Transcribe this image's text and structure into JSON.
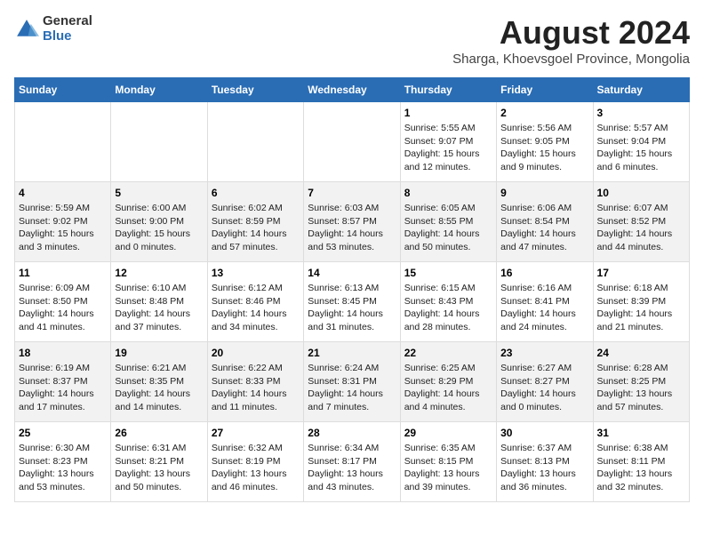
{
  "logo": {
    "general": "General",
    "blue": "Blue"
  },
  "title": "August 2024",
  "subtitle": "Sharga, Khoevsgoel Province, Mongolia",
  "days_of_week": [
    "Sunday",
    "Monday",
    "Tuesday",
    "Wednesday",
    "Thursday",
    "Friday",
    "Saturday"
  ],
  "weeks": [
    [
      {
        "day": "",
        "info": ""
      },
      {
        "day": "",
        "info": ""
      },
      {
        "day": "",
        "info": ""
      },
      {
        "day": "",
        "info": ""
      },
      {
        "day": "1",
        "info": "Sunrise: 5:55 AM\nSunset: 9:07 PM\nDaylight: 15 hours\nand 12 minutes."
      },
      {
        "day": "2",
        "info": "Sunrise: 5:56 AM\nSunset: 9:05 PM\nDaylight: 15 hours\nand 9 minutes."
      },
      {
        "day": "3",
        "info": "Sunrise: 5:57 AM\nSunset: 9:04 PM\nDaylight: 15 hours\nand 6 minutes."
      }
    ],
    [
      {
        "day": "4",
        "info": "Sunrise: 5:59 AM\nSunset: 9:02 PM\nDaylight: 15 hours\nand 3 minutes."
      },
      {
        "day": "5",
        "info": "Sunrise: 6:00 AM\nSunset: 9:00 PM\nDaylight: 15 hours\nand 0 minutes."
      },
      {
        "day": "6",
        "info": "Sunrise: 6:02 AM\nSunset: 8:59 PM\nDaylight: 14 hours\nand 57 minutes."
      },
      {
        "day": "7",
        "info": "Sunrise: 6:03 AM\nSunset: 8:57 PM\nDaylight: 14 hours\nand 53 minutes."
      },
      {
        "day": "8",
        "info": "Sunrise: 6:05 AM\nSunset: 8:55 PM\nDaylight: 14 hours\nand 50 minutes."
      },
      {
        "day": "9",
        "info": "Sunrise: 6:06 AM\nSunset: 8:54 PM\nDaylight: 14 hours\nand 47 minutes."
      },
      {
        "day": "10",
        "info": "Sunrise: 6:07 AM\nSunset: 8:52 PM\nDaylight: 14 hours\nand 44 minutes."
      }
    ],
    [
      {
        "day": "11",
        "info": "Sunrise: 6:09 AM\nSunset: 8:50 PM\nDaylight: 14 hours\nand 41 minutes."
      },
      {
        "day": "12",
        "info": "Sunrise: 6:10 AM\nSunset: 8:48 PM\nDaylight: 14 hours\nand 37 minutes."
      },
      {
        "day": "13",
        "info": "Sunrise: 6:12 AM\nSunset: 8:46 PM\nDaylight: 14 hours\nand 34 minutes."
      },
      {
        "day": "14",
        "info": "Sunrise: 6:13 AM\nSunset: 8:45 PM\nDaylight: 14 hours\nand 31 minutes."
      },
      {
        "day": "15",
        "info": "Sunrise: 6:15 AM\nSunset: 8:43 PM\nDaylight: 14 hours\nand 28 minutes."
      },
      {
        "day": "16",
        "info": "Sunrise: 6:16 AM\nSunset: 8:41 PM\nDaylight: 14 hours\nand 24 minutes."
      },
      {
        "day": "17",
        "info": "Sunrise: 6:18 AM\nSunset: 8:39 PM\nDaylight: 14 hours\nand 21 minutes."
      }
    ],
    [
      {
        "day": "18",
        "info": "Sunrise: 6:19 AM\nSunset: 8:37 PM\nDaylight: 14 hours\nand 17 minutes."
      },
      {
        "day": "19",
        "info": "Sunrise: 6:21 AM\nSunset: 8:35 PM\nDaylight: 14 hours\nand 14 minutes."
      },
      {
        "day": "20",
        "info": "Sunrise: 6:22 AM\nSunset: 8:33 PM\nDaylight: 14 hours\nand 11 minutes."
      },
      {
        "day": "21",
        "info": "Sunrise: 6:24 AM\nSunset: 8:31 PM\nDaylight: 14 hours\nand 7 minutes."
      },
      {
        "day": "22",
        "info": "Sunrise: 6:25 AM\nSunset: 8:29 PM\nDaylight: 14 hours\nand 4 minutes."
      },
      {
        "day": "23",
        "info": "Sunrise: 6:27 AM\nSunset: 8:27 PM\nDaylight: 14 hours\nand 0 minutes."
      },
      {
        "day": "24",
        "info": "Sunrise: 6:28 AM\nSunset: 8:25 PM\nDaylight: 13 hours\nand 57 minutes."
      }
    ],
    [
      {
        "day": "25",
        "info": "Sunrise: 6:30 AM\nSunset: 8:23 PM\nDaylight: 13 hours\nand 53 minutes."
      },
      {
        "day": "26",
        "info": "Sunrise: 6:31 AM\nSunset: 8:21 PM\nDaylight: 13 hours\nand 50 minutes."
      },
      {
        "day": "27",
        "info": "Sunrise: 6:32 AM\nSunset: 8:19 PM\nDaylight: 13 hours\nand 46 minutes."
      },
      {
        "day": "28",
        "info": "Sunrise: 6:34 AM\nSunset: 8:17 PM\nDaylight: 13 hours\nand 43 minutes."
      },
      {
        "day": "29",
        "info": "Sunrise: 6:35 AM\nSunset: 8:15 PM\nDaylight: 13 hours\nand 39 minutes."
      },
      {
        "day": "30",
        "info": "Sunrise: 6:37 AM\nSunset: 8:13 PM\nDaylight: 13 hours\nand 36 minutes."
      },
      {
        "day": "31",
        "info": "Sunrise: 6:38 AM\nSunset: 8:11 PM\nDaylight: 13 hours\nand 32 minutes."
      }
    ]
  ]
}
